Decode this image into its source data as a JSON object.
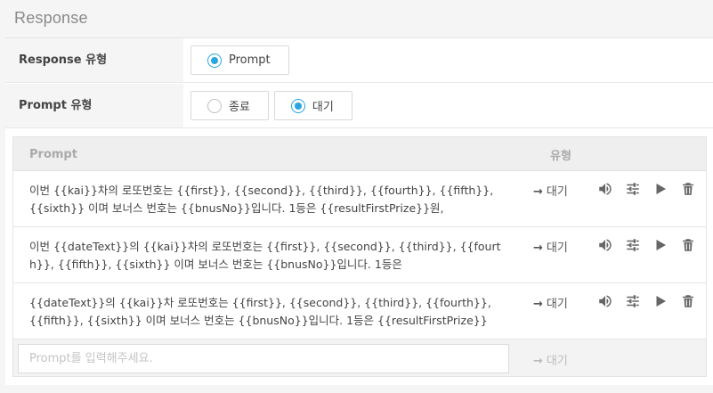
{
  "section_title": "Response",
  "response_type": {
    "label": "Response 유형",
    "options": [
      {
        "label": "Prompt",
        "checked": true
      }
    ]
  },
  "prompt_type": {
    "label": "Prompt 유형",
    "options": [
      {
        "label": "종료",
        "checked": false
      },
      {
        "label": "대기",
        "checked": true
      }
    ]
  },
  "table": {
    "headers": {
      "prompt": "Prompt",
      "type": "유형"
    },
    "rows": [
      {
        "text": "이번 {{kai}}차의 로또번호는 {{first}}, {{second}}, {{third}}, {{fourth}}, {{fifth}}, {{sixth}} 이며 보너스 번호는 {{bnusNo}}입니다. 1등은 {{resultFirstPrize}}원,",
        "type_arrow": "→",
        "type": "대기"
      },
      {
        "text": "이번 {{dateText}}의 {{kai}}차의 로또번호는 {{first}}, {{second}}, {{third}}, {{fourth}}, {{fifth}}, {{sixth}} 이며 보너스 번호는 {{bnusNo}}입니다. 1등은",
        "type_arrow": "→",
        "type": "대기"
      },
      {
        "text": "{{dateText}}의 {{kai}}차 로또번호는 {{first}}, {{second}}, {{third}}, {{fourth}}, {{fifth}}, {{sixth}} 이며 보너스 번호는 {{bnusNo}}입니다. 1등은 {{resultFirstPrize}}",
        "type_arrow": "→",
        "type": "대기"
      }
    ],
    "row_icons": [
      "volume-icon",
      "sliders-icon",
      "play-icon",
      "trash-icon"
    ]
  },
  "new_prompt": {
    "placeholder": "Prompt를 입력해주세요.",
    "type_arrow": "→",
    "type": "대기"
  },
  "colors": {
    "accent": "#29a6e0",
    "header_bg": "#efefef",
    "label_bg": "#f5f5f5"
  }
}
